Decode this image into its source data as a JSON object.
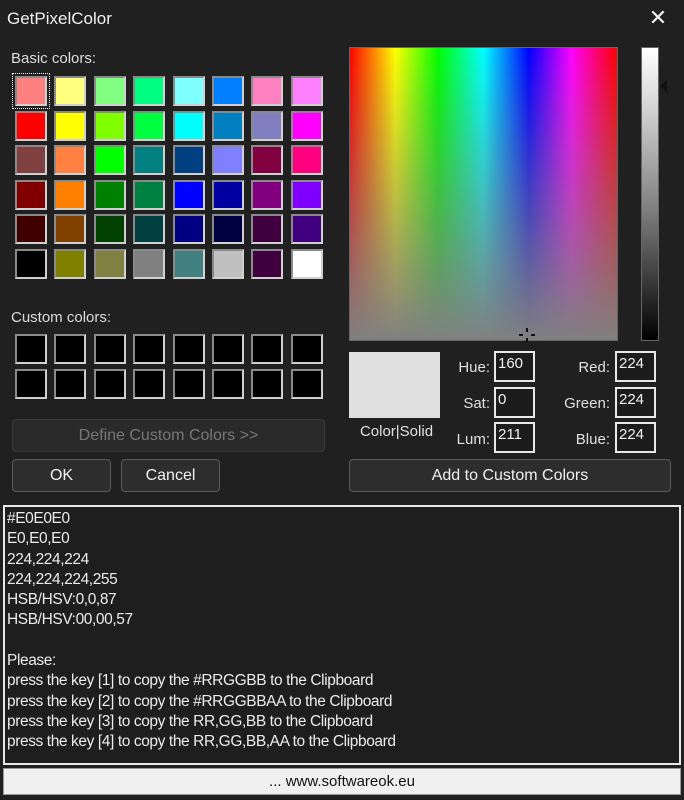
{
  "window": {
    "title": "GetPixelColor",
    "close_icon": "close-icon"
  },
  "basic_colors": {
    "label": "Basic colors:",
    "selected_index": 0,
    "colors": [
      "#FF8080",
      "#FFFF80",
      "#80FF80",
      "#00FF80",
      "#80FFFF",
      "#0080FF",
      "#FF80C0",
      "#FF80FF",
      "#FF0000",
      "#FFFF00",
      "#80FF00",
      "#00FF40",
      "#00FFFF",
      "#0080C0",
      "#8080C0",
      "#FF00FF",
      "#804040",
      "#FF8040",
      "#00FF00",
      "#008080",
      "#004080",
      "#8080FF",
      "#800040",
      "#FF0080",
      "#800000",
      "#FF8000",
      "#008000",
      "#008040",
      "#0000FF",
      "#0000A0",
      "#800080",
      "#8000FF",
      "#400000",
      "#804000",
      "#004000",
      "#004040",
      "#000080",
      "#000040",
      "#400040",
      "#400080",
      "#000000",
      "#808000",
      "#808040",
      "#808080",
      "#408080",
      "#C0C0C0",
      "#400040",
      "#FFFFFF"
    ]
  },
  "custom_colors": {
    "label": "Custom colors:",
    "colors": [
      "#000000",
      "#000000",
      "#000000",
      "#000000",
      "#000000",
      "#000000",
      "#000000",
      "#000000",
      "#000000",
      "#000000",
      "#000000",
      "#000000",
      "#000000",
      "#000000",
      "#000000",
      "#000000"
    ]
  },
  "buttons": {
    "define": "Define Custom Colors >>",
    "ok": "OK",
    "cancel": "Cancel",
    "add": "Add to Custom Colors"
  },
  "preview": {
    "color": "#E0E0E0",
    "label": "Color|Solid"
  },
  "fields": {
    "hue_label": "Hue:",
    "hue": "160",
    "sat_label": "Sat:",
    "sat": "0",
    "lum_label": "Lum:",
    "lum": "211",
    "red_label": "Red:",
    "red": "224",
    "green_label": "Green:",
    "green": "224",
    "blue_label": "Blue:",
    "blue": "224"
  },
  "info_lines": [
    "#E0E0E0",
    "E0,E0,E0",
    "224,224,224",
    "224,224,224,255",
    "HSB/HSV:0,0,87",
    "HSB/HSV:00,00,57",
    "",
    "Please:",
    "press the key [1] to copy the #RRGGBB to the Clipboard",
    "press the key [2] to copy the #RRGGBBAA to the Clipboard",
    "press the key [3] to copy the RR,GG,BB to the Clipboard",
    "press the key [4] to copy the RR,GG,BB,AA to the Clipboard"
  ],
  "footer": "...  www.softwareok.eu"
}
